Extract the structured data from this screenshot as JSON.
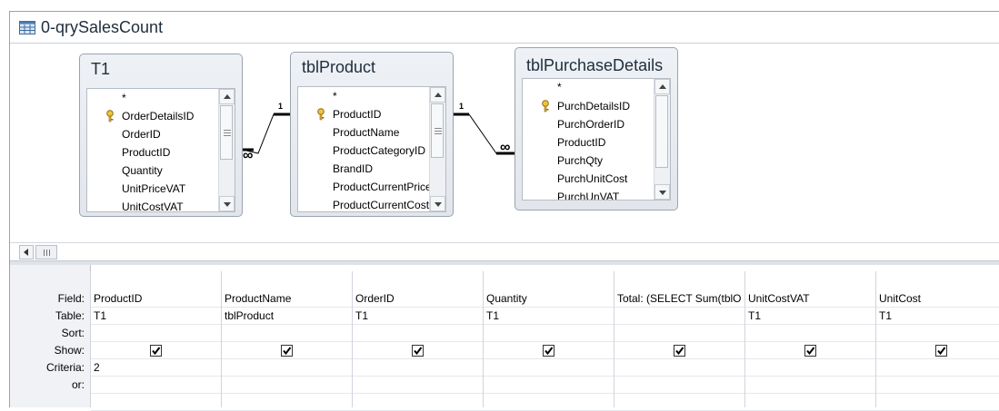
{
  "window": {
    "title": "0-qrySalesCount"
  },
  "tables": [
    {
      "name": "T1",
      "fields": [
        "*",
        "OrderDetailsID",
        "OrderID",
        "ProductID",
        "Quantity",
        "UnitPriceVAT",
        "UnitCostVAT"
      ],
      "key_index": 1
    },
    {
      "name": "tblProduct",
      "fields": [
        "*",
        "ProductID",
        "ProductName",
        "ProductCategoryID",
        "BrandID",
        "ProductCurrentPrice",
        "ProductCurrentCost"
      ],
      "key_index": 1
    },
    {
      "name": "tblPurchaseDetails",
      "fields": [
        "*",
        "PurchDetailsID",
        "PurchOrderID",
        "ProductID",
        "PurchQty",
        "PurchUnitCost",
        "PurchUnVAT"
      ],
      "key_index": 1
    }
  ],
  "relationships": [
    {
      "one_label": "1",
      "many_label": "∞"
    },
    {
      "one_label": "1",
      "many_label": "∞"
    }
  ],
  "grid": {
    "row_labels": [
      "Field:",
      "Table:",
      "Sort:",
      "Show:",
      "Criteria:",
      "or:"
    ],
    "columns": [
      {
        "field": "ProductID",
        "table": "T1",
        "sort": "",
        "show": true,
        "criteria": "2",
        "or": ""
      },
      {
        "field": "ProductName",
        "table": "tblProduct",
        "sort": "",
        "show": true,
        "criteria": "",
        "or": ""
      },
      {
        "field": "OrderID",
        "table": "T1",
        "sort": "",
        "show": true,
        "criteria": "",
        "or": ""
      },
      {
        "field": "Quantity",
        "table": "T1",
        "sort": "",
        "show": true,
        "criteria": "",
        "or": ""
      },
      {
        "field": "Total: (SELECT Sum(tblO",
        "table": "",
        "sort": "",
        "show": true,
        "criteria": "",
        "or": ""
      },
      {
        "field": "UnitCostVAT",
        "table": "T1",
        "sort": "",
        "show": true,
        "criteria": "",
        "or": ""
      },
      {
        "field": "UnitCost",
        "table": "T1",
        "sort": "",
        "show": true,
        "criteria": "",
        "or": ""
      }
    ]
  }
}
